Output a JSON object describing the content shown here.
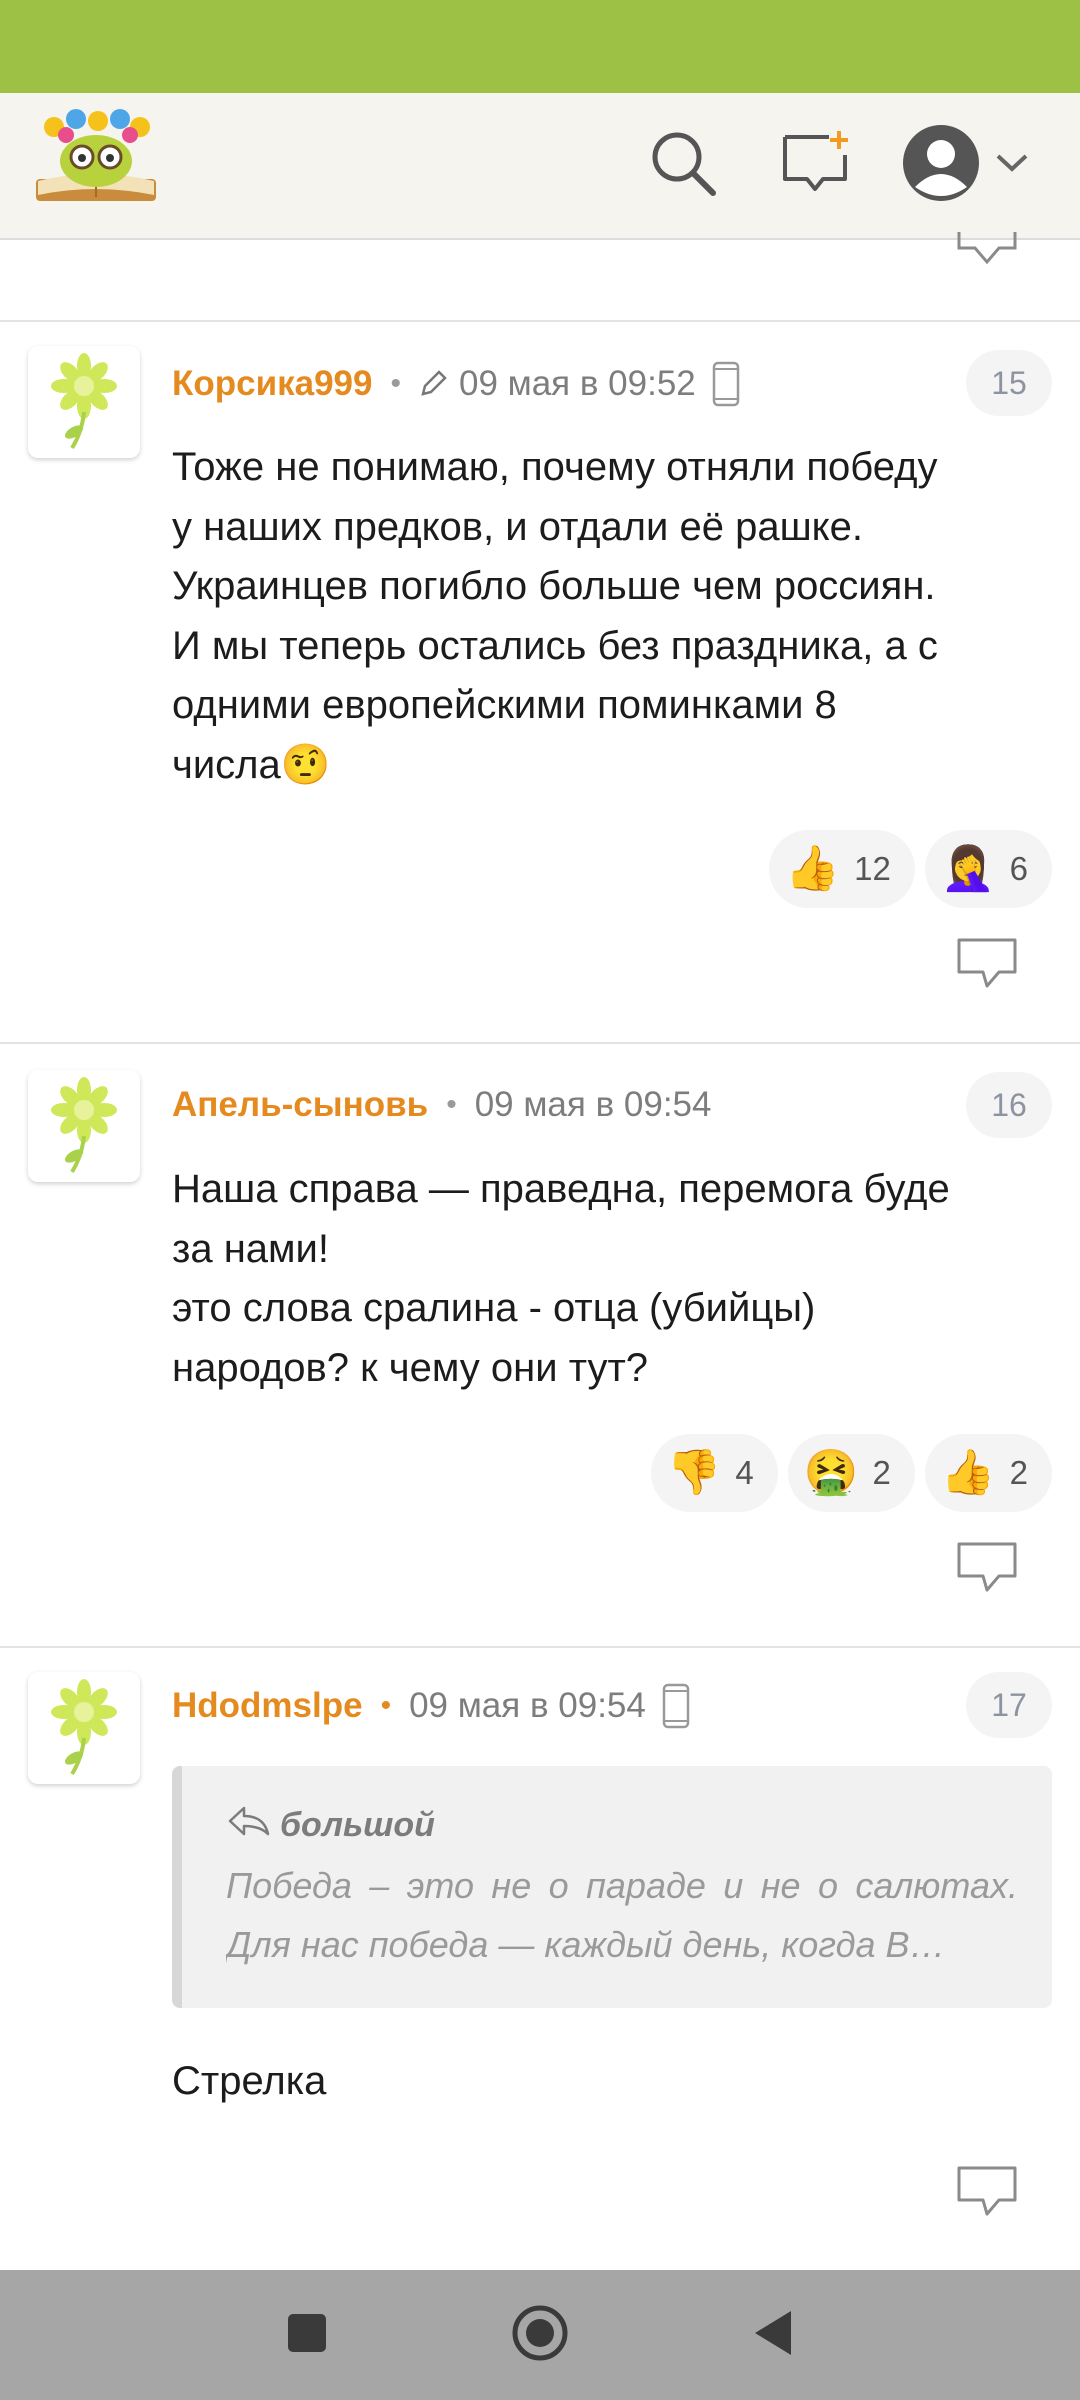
{
  "colors": {
    "status_bar": "#9dc144",
    "accent_orange": "#e58a1f",
    "nav_bar": "#a6a6a6"
  },
  "header": {
    "logo_icon": "book-owl-logo",
    "icons": [
      "search-icon",
      "new-message-icon",
      "profile-avatar-icon",
      "chevron-down-icon"
    ]
  },
  "comments": [
    {
      "author": "Корсика999",
      "edited": true,
      "date": "09 мая в 09:52",
      "mobile": true,
      "number": "15",
      "lines": [
        "Тоже не понимаю, почему отняли победу",
        "у наших предков, и отдали её рашке.",
        "Украинцев погибло больше чем россиян.",
        "И мы теперь остались без праздника, а с",
        "одними европейскими поминками 8",
        "числа🤨"
      ],
      "reactions": [
        {
          "emoji": "👍",
          "count": "12"
        },
        {
          "emoji": "🤦‍♀️",
          "count": "6"
        }
      ]
    },
    {
      "author": "Апель-сыновь",
      "edited": false,
      "date": "09 мая в 09:54",
      "mobile": false,
      "number": "16",
      "lines": [
        "Наша справа — праведна, перемога буде",
        "за нами!",
        "это слова сралина - отца (убийцы)",
        "народов? к чему они тут?"
      ],
      "reactions": [
        {
          "emoji": "👎",
          "count": "4"
        },
        {
          "emoji": "🤮",
          "count": "2"
        },
        {
          "emoji": "👍",
          "count": "2"
        }
      ]
    },
    {
      "author": "Hdodmslpe",
      "edited": false,
      "date": "09 мая в 09:54",
      "mobile": true,
      "number": "17",
      "quote": {
        "author": "большой",
        "text": "Победа – это не о параде и не о салютах. Для нас победа — каждый день, когда В…"
      },
      "lines": [
        "Стрелка"
      ],
      "reactions": []
    }
  ],
  "nav": {
    "icons": [
      "recent-apps-icon",
      "home-icon",
      "back-icon"
    ]
  }
}
